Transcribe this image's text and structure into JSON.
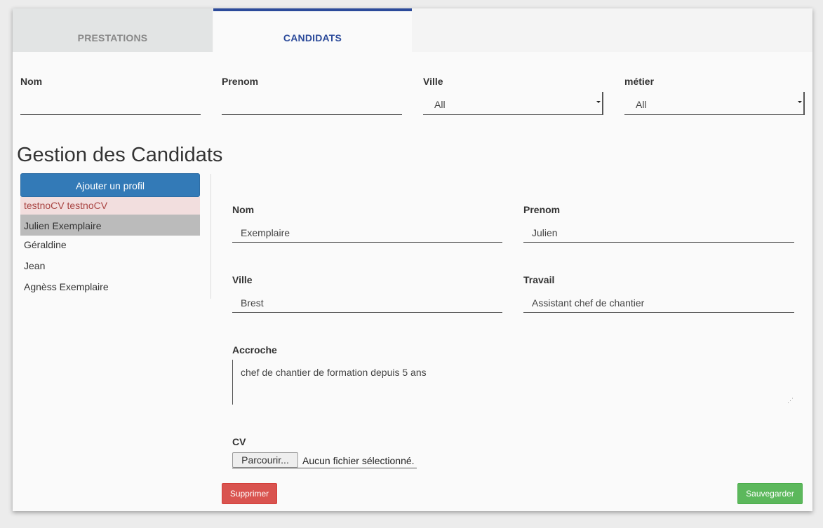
{
  "tabs": [
    {
      "label": "PRESTATIONS"
    },
    {
      "label": "CANDIDATS"
    }
  ],
  "filters": {
    "nom_label": "Nom",
    "prenom_label": "Prenom",
    "ville_label": "Ville",
    "ville_value": "All",
    "metier_label": "métier",
    "metier_value": "All"
  },
  "page_title": "Gestion des Candidats",
  "add_profile_label": "Ajouter un profil",
  "profiles": [
    {
      "name": "testnoCV testnoCV"
    },
    {
      "name": "Julien Exemplaire"
    },
    {
      "name": "Géraldine"
    },
    {
      "name": "Jean"
    },
    {
      "name": "Agnèss Exemplaire"
    }
  ],
  "detail": {
    "nom_label": "Nom",
    "nom_value": "Exemplaire",
    "prenom_label": "Prenom",
    "prenom_value": "Julien",
    "ville_label": "Ville",
    "ville_value": "Brest",
    "travail_label": "Travail",
    "travail_value": "Assistant chef de chantier",
    "accroche_label": "Accroche",
    "accroche_value": "chef de chantier de formation depuis 5 ans",
    "cv_label": "CV",
    "browse_label": "Parcourir...",
    "no_file_label": "Aucun fichier sélectionné."
  },
  "delete_label": "Supprimer",
  "save_label": "Sauvegarder",
  "colors": {
    "tab_active": "#2b4a9a",
    "primary": "#337ab7",
    "danger": "#d9534f",
    "success": "#5cb85c",
    "error_bg": "#f2dede",
    "selected_bg": "#bbbbbb"
  }
}
